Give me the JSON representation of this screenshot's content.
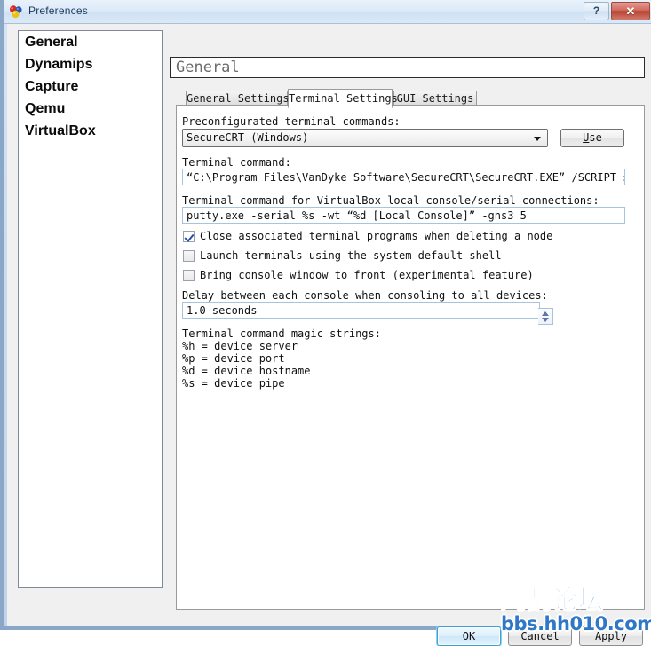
{
  "window": {
    "title": "Preferences",
    "icon": "balloons-icon",
    "help_label": "?",
    "close_label": "✕"
  },
  "sidebar": {
    "items": [
      {
        "label": "General"
      },
      {
        "label": "Dynamips"
      },
      {
        "label": "Capture"
      },
      {
        "label": "Qemu"
      },
      {
        "label": "VirtualBox"
      }
    ],
    "selected": "General"
  },
  "page": {
    "title": "General"
  },
  "tabs": [
    {
      "label": "General Settings",
      "active": false
    },
    {
      "label": "Terminal Settings",
      "active": true
    },
    {
      "label": "GUI Settings",
      "active": false
    }
  ],
  "terminal_settings": {
    "preconfigured_label": "Preconfigurated terminal commands:",
    "preconfigured_value": "SecureCRT (Windows)",
    "use_button": {
      "mnemonic": "U",
      "rest": "se"
    },
    "terminal_command_label": "Terminal command:",
    "terminal_command_value": "“C:\\Program Files\\VanDyke Software\\SecureCRT\\SecureCRT.EXE” /SCRIPT securecrt.vbs ",
    "vbox_command_label": "Terminal command for VirtualBox local console/serial connections:",
    "vbox_command_value": "putty.exe -serial %s -wt “%d [Local Console]” -gns3 5",
    "checkboxes": [
      {
        "label": "Close associated terminal programs when deleting a node",
        "checked": true
      },
      {
        "label": "Launch terminals using the system default shell",
        "checked": false
      },
      {
        "label": "Bring console window to front (experimental feature)",
        "checked": false
      }
    ],
    "delay_label": "Delay between each console when consoling to all devices:",
    "delay_value": "1.0 seconds",
    "magic_title": "Terminal command magic strings:",
    "magic_strings": [
      "%h = device server",
      "%p = device port",
      "%d = device hostname",
      "%s = device pipe"
    ]
  },
  "footer": {
    "ok": "OK",
    "cancel": "Cancel",
    "apply": "Apply"
  },
  "watermark": {
    "cn": "鸿鹄论坛",
    "url": "bbs.hh010.com",
    "color": "#2f78c8"
  }
}
